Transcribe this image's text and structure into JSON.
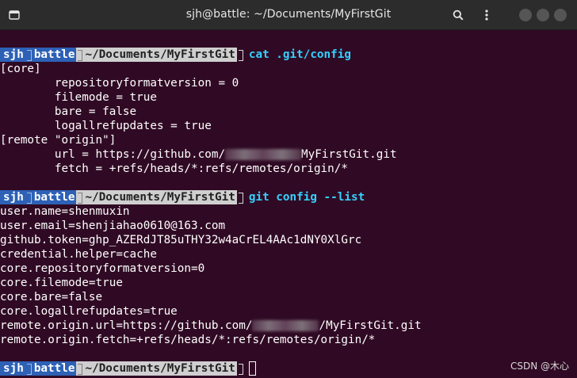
{
  "window": {
    "title": "sjh@battle: ~/Documents/MyFirstGit",
    "new_tab_icon": "terminal-tab-icon",
    "search_icon": "search-icon",
    "menu_icon": "vertical-ellipsis-icon"
  },
  "prompt": {
    "user": "sjh",
    "host": "battle",
    "dir": "~/Documents/MyFirstGit"
  },
  "blocks": [
    {
      "command": "cat .git/config",
      "output": [
        "[core]",
        "        repositoryformatversion = 0",
        "        filemode = true",
        "        bare = false",
        "        logallrefupdates = true",
        "[remote \"origin\"]",
        {
          "before": "        url = https://github.com/",
          "after": "MyFirstGit.git"
        },
        "        fetch = +refs/heads/*:refs/remotes/origin/*"
      ]
    },
    {
      "command": "git config --list",
      "output": [
        "user.name=shenmuxin",
        "user.email=shenjiahao0610@163.com",
        "github.token=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",
        "credential.helper=cache",
        "core.repositoryformatversion=0",
        "core.filemode=true",
        "core.bare=false",
        "core.logallrefupdates=true",
        {
          "before": "remote.origin.url=https://github.com/",
          "after": "/MyFirstGit.git"
        },
        "remote.origin.fetch=+refs/heads/*:refs/remotes/origin/*"
      ]
    }
  ],
  "watermark": "CSDN @木心",
  "colors": {
    "background": "#300a24",
    "prompt_blue": "#2d61b6",
    "prompt_gray": "#cfcfcf",
    "command": "#34d1ff"
  }
}
